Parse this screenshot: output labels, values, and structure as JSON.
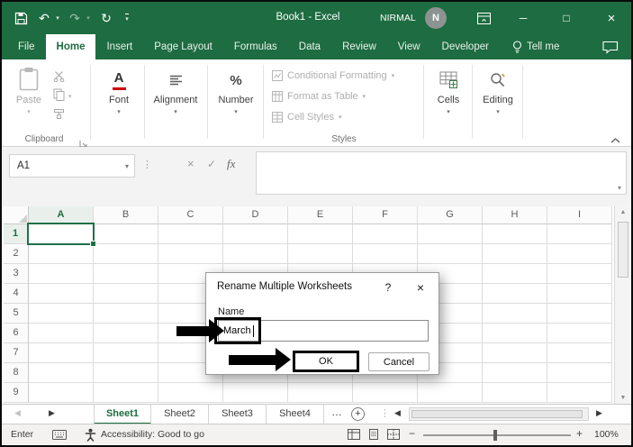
{
  "colors": {
    "accent_green": "#217346",
    "titlebar_green": "#1E6C41",
    "annotation_black": "#000000",
    "disabled_gray": "#AEAEAE"
  },
  "titlebar": {
    "title": "Book1 - Excel",
    "user_name": "NIRMAL",
    "avatar_initial": "N"
  },
  "ribbon_tabs": [
    {
      "label": "File"
    },
    {
      "label": "Home"
    },
    {
      "label": "Insert"
    },
    {
      "label": "Page Layout"
    },
    {
      "label": "Formulas"
    },
    {
      "label": "Data"
    },
    {
      "label": "Review"
    },
    {
      "label": "View"
    },
    {
      "label": "Developer"
    }
  ],
  "tell_me_label": "Tell me",
  "ribbon": {
    "paste_label": "Paste",
    "font_label": "Font",
    "alignment_label": "Alignment",
    "number_label": "Number",
    "styles_buttons": [
      {
        "label": "Conditional Formatting"
      },
      {
        "label": "Format as Table"
      },
      {
        "label": "Cell Styles"
      }
    ],
    "cells_label": "Cells",
    "editing_label": "Editing",
    "clipboard_group_label": "Clipboard",
    "styles_group_label": "Styles"
  },
  "formula_bar": {
    "name_box_value": "A1",
    "fx_label": "fx"
  },
  "grid": {
    "columns": [
      "A",
      "B",
      "C",
      "D",
      "E",
      "F",
      "G",
      "H",
      "I"
    ],
    "rows": [
      "1",
      "2",
      "3",
      "4",
      "5",
      "6",
      "7",
      "8",
      "9"
    ],
    "selected_cell": "A1"
  },
  "dialog": {
    "title": "Rename Multiple Worksheets",
    "name_field_label": "Name",
    "name_input_value": "March",
    "ok_label": "OK",
    "cancel_label": "Cancel"
  },
  "sheet_tabs": [
    {
      "label": "Sheet1"
    },
    {
      "label": "Sheet2"
    },
    {
      "label": "Sheet3"
    },
    {
      "label": "Sheet4"
    }
  ],
  "status_bar": {
    "mode": "Enter",
    "accessibility_status": "Accessibility: Good to go",
    "zoom_level": "100%"
  },
  "icons": {
    "undo": "↶",
    "redo": "↷",
    "refresh": "↻",
    "caret_down": "▾",
    "minimize": "─",
    "maximize": "□",
    "close": "×",
    "dots_handle": "⋮",
    "formula_cancel": "×",
    "formula_check": "✓",
    "help": "?",
    "dialog_close": "×",
    "tabs_overflow": "…",
    "add_sheet": "+",
    "nav_left": "◀",
    "nav_right": "▶",
    "scroll_up": "▲",
    "scroll_down": "▼",
    "zoom_out": "−",
    "zoom_in": "+",
    "percent_icon": "%",
    "font_icon_letter": "A"
  }
}
